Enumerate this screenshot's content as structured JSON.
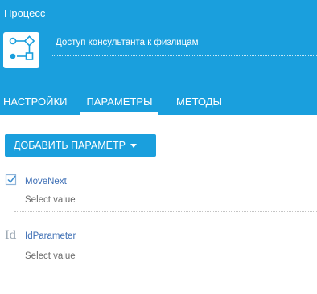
{
  "header": {
    "title": "Процесс",
    "process_name": "Доступ консультанта к физлицам",
    "icon": "process-flow-icon",
    "background_color": "#1a9fdd"
  },
  "tabs": [
    {
      "label": "НАСТРОЙКИ",
      "active": false
    },
    {
      "label": "ПАРАМЕТРЫ",
      "active": true
    },
    {
      "label": "МЕТОДЫ",
      "active": false
    }
  ],
  "toolbar": {
    "add_parameter_label": "ДОБАВИТЬ ПАРАМЕТР",
    "add_parameter_icon": "chevron-down-icon"
  },
  "parameters": [
    {
      "icon": "checkbox-icon",
      "name": "MoveNext",
      "value_placeholder": "Select value"
    },
    {
      "icon": "id-icon",
      "icon_text": "Id",
      "name": "IdParameter",
      "value_placeholder": "Select value"
    }
  ]
}
